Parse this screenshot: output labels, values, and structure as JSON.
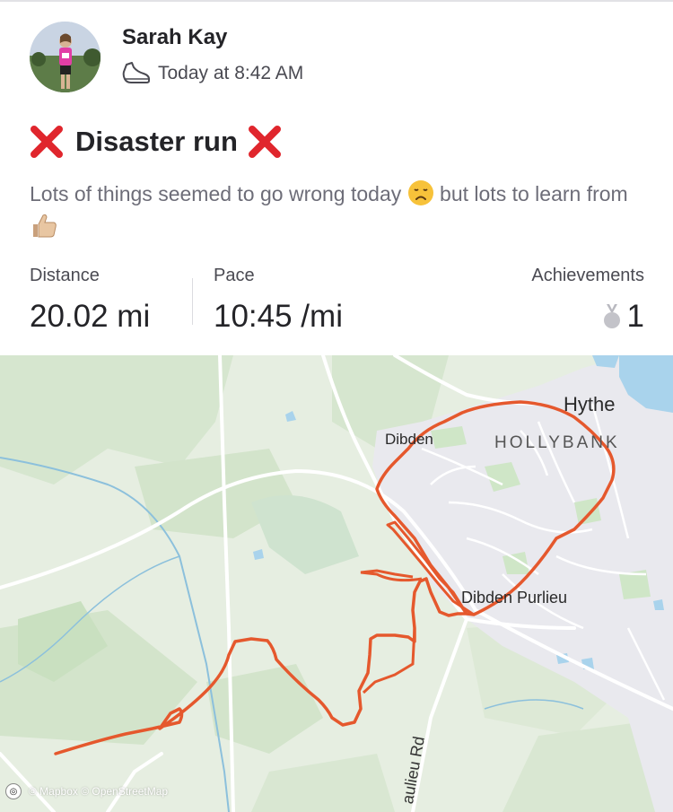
{
  "athlete": {
    "name": "Sarah Kay",
    "timestamp": "Today at 8:42 AM",
    "activity_icon": "running-shoe-icon"
  },
  "activity": {
    "title": "Disaster run",
    "title_icon": "cross-mark-icon",
    "description_part1": "Lots of things seemed to go wrong today ",
    "description_emoji1": "disappointed-face-emoji",
    "description_part2": " but lots to learn from ",
    "description_emoji2": "thumbs-up-emoji"
  },
  "stats": {
    "distance_label": "Distance",
    "distance_value": "20.02 mi",
    "pace_label": "Pace",
    "pace_value": "10:45 /mi",
    "achievements_label": "Achievements",
    "achievements_value": "1",
    "achievements_icon": "medal-icon"
  },
  "map": {
    "labels": {
      "hythe": "Hythe",
      "dibden": "Dibden",
      "hollybank": "HOLLYBANK",
      "purlieu": "Dibden Purlieu",
      "road": "aulieu Rd"
    },
    "attribution": "© Mapbox © OpenStreetMap",
    "route_color": "#e5582d",
    "water_color": "#a9d3ec",
    "urban_color": "#e9e9ee"
  }
}
